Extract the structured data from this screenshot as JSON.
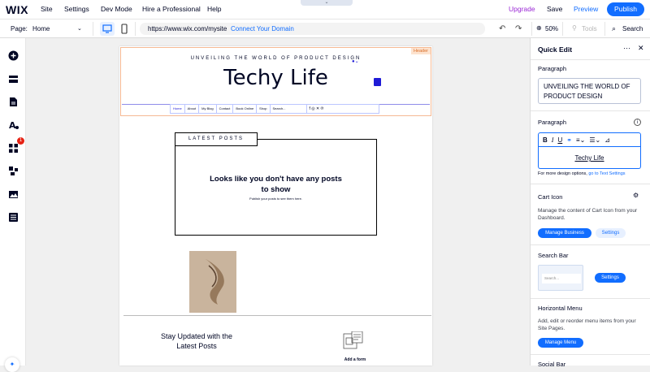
{
  "topbar": {
    "logo": "WIX",
    "menu": [
      "Site",
      "Settings",
      "Dev Mode",
      "Hire a Professional",
      "Help"
    ],
    "upgrade": "Upgrade",
    "save": "Save",
    "preview": "Preview",
    "publish": "Publish",
    "notch_glyph": "⌄"
  },
  "secondbar": {
    "page_label": "Page:",
    "page_name": "Home",
    "url": "https://www.wix.com/mysite",
    "connect_domain": "Connect Your Domain",
    "zoom": "50%",
    "tools": "Tools",
    "search": "Search"
  },
  "leftbar": {
    "icons": [
      "add-icon",
      "sections-icon",
      "pages-icon",
      "design-icon",
      "apps-icon",
      "business-icon",
      "media-icon",
      "cms-icon"
    ],
    "apps_badge": "1"
  },
  "site": {
    "header_tag": "Header",
    "tagline": "UNVEILING THE WORLD OF PRODUCT DESIGN",
    "title": "Techy Life",
    "nav": [
      "Home",
      "About",
      "My Blog",
      "Contact",
      "Book Online",
      "Shop"
    ],
    "nav_search_placeholder": "Search...",
    "social_icons": "f ◎ ✕ ℗",
    "latest_posts": "LATEST POSTS",
    "no_posts_title": "Looks like you don't have any posts to show",
    "no_posts_sub": "Publish your posts to see them here.",
    "stay_updated": "Stay Updated with the Latest Posts",
    "add_form": "Add a form"
  },
  "quick_edit": {
    "title": "Quick Edit",
    "paragraph1_label": "Paragraph",
    "paragraph1_value": "UNVEILING THE WORLD OF PRODUCT DESIGN",
    "paragraph2_label": "Paragraph",
    "paragraph2_value": "Techy Life",
    "design_options_text": "For more design options,",
    "design_options_link": "go to Text Settings",
    "cart_label": "Cart Icon",
    "cart_desc": "Manage the content of Cart Icon from your Dashboard.",
    "manage_business": "Manage Business",
    "settings1": "Settings",
    "search_bar_label": "Search Bar",
    "search_placeholder": "Search...",
    "settings2": "Settings",
    "horizontal_menu_label": "Horizontal Menu",
    "horizontal_menu_desc": "Add, edit or reorder menu items from your Site Pages.",
    "manage_menu": "Manage Menu",
    "social_bar_label": "Social Bar"
  }
}
